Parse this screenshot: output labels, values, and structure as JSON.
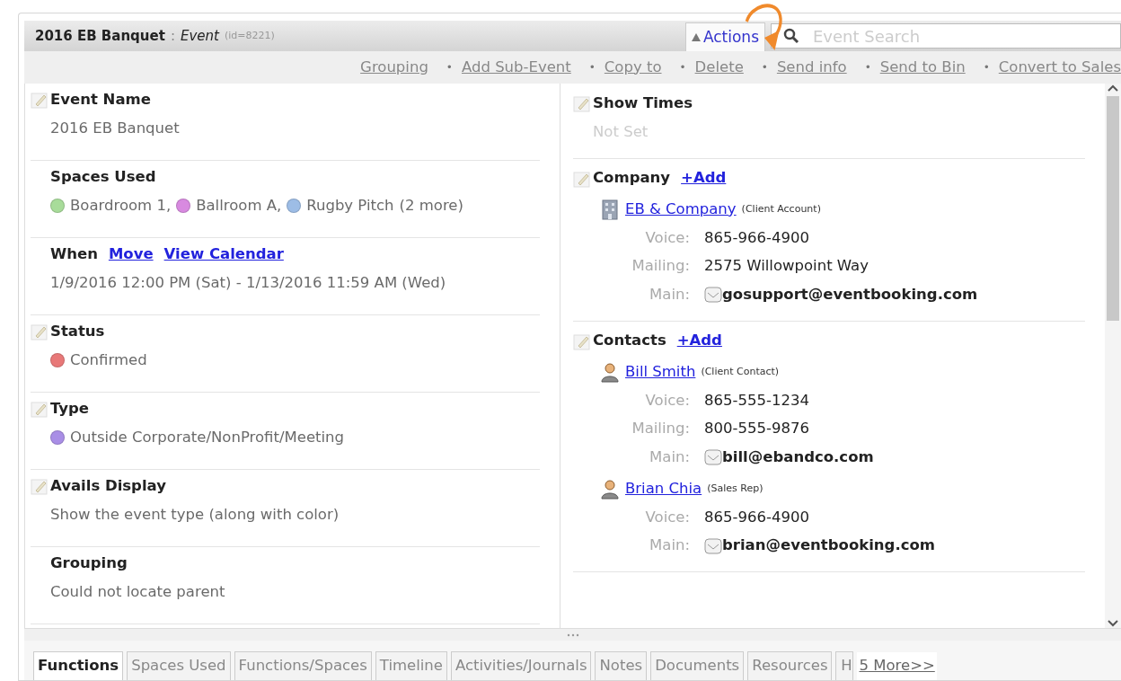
{
  "header": {
    "title": "2016 EB Banquet",
    "separator": ":",
    "type": "Event",
    "id": "(id=8221)",
    "actions_label": "Actions",
    "search": {
      "placeholder": "Event Search"
    }
  },
  "toolbar": [
    {
      "label": "Grouping"
    },
    {
      "bullet": "•",
      "label": "Add Sub-Event"
    },
    {
      "bullet": "•",
      "label": "Copy to"
    },
    {
      "bullet": "•",
      "label": "Delete"
    },
    {
      "bullet": "•",
      "label": "Send info"
    },
    {
      "bullet": "•",
      "label": "Send to Bin"
    },
    {
      "bullet": "•",
      "label": "Convert to Sales"
    }
  ],
  "left_fields": [
    {
      "label": "Event Name",
      "editable": true,
      "kind": "text",
      "value": "2016 EB Banquet"
    },
    {
      "label": "Spaces Used",
      "editable": false,
      "kind": "dots",
      "items": [
        {
          "text": "Boardroom 1,",
          "color": "#a8dc9a"
        },
        {
          "text": "Ballroom A,",
          "color": "#d88ae0"
        },
        {
          "text": "Rugby Pitch",
          "color": "#9dbde6"
        }
      ],
      "more": "(2 more)"
    },
    {
      "label": "When",
      "editable": false,
      "kind": "text",
      "links": [
        "Move",
        "View Calendar"
      ],
      "value": "1/9/2016 12:00 PM (Sat) - 1/13/2016 11:59 AM (Wed)"
    },
    {
      "label": "Status",
      "editable": true,
      "kind": "dots",
      "items": [
        {
          "text": "Confirmed",
          "color": "#e87878"
        }
      ]
    },
    {
      "label": "Type",
      "editable": true,
      "kind": "dots",
      "items": [
        {
          "text": "Outside Corporate/NonProfit/Meeting",
          "color": "#a98ee6"
        }
      ]
    },
    {
      "label": "Avails Display",
      "editable": true,
      "kind": "text",
      "value": "Show the event type (along with color)"
    },
    {
      "label": "Grouping",
      "editable": false,
      "kind": "text",
      "value": "Could not locate parent"
    }
  ],
  "right_sections": [
    {
      "label": "Show Times",
      "editable": true,
      "kind": "text",
      "value": "Not Set",
      "unset": true
    },
    {
      "label": "Company",
      "editable": true,
      "add_link": "+Add",
      "kind": "entities",
      "entities": [
        {
          "kind": "company",
          "name": "EB & Company",
          "role": "(Client Account)",
          "details": [
            {
              "label": "Voice:",
              "value": "865-966-4900",
              "email": false
            },
            {
              "label": "Mailing:",
              "value": "2575 Willowpoint Way",
              "email": false
            },
            {
              "label": "Main:",
              "value": "gosupport@eventbooking.com",
              "email": true
            }
          ]
        }
      ]
    },
    {
      "label": "Contacts",
      "editable": true,
      "add_link": "+Add",
      "kind": "entities",
      "entities": [
        {
          "kind": "person",
          "name": "Bill Smith",
          "role": "(Client Contact)",
          "details": [
            {
              "label": "Voice:",
              "value": "865-555-1234",
              "email": false
            },
            {
              "label": "Mailing:",
              "value": "800-555-9876",
              "email": false
            },
            {
              "label": "Main:",
              "value": "bill@ebandco.com",
              "email": true
            }
          ]
        },
        {
          "kind": "person",
          "name": "Brian Chia",
          "role": "(Sales Rep)",
          "details": [
            {
              "label": "Voice:",
              "value": "865-966-4900",
              "email": false
            },
            {
              "label": "Main:",
              "value": "brian@eventbooking.com",
              "email": true
            }
          ]
        }
      ]
    }
  ],
  "tabs": [
    {
      "label": "Functions",
      "selected": true
    },
    {
      "label": "Spaces Used",
      "selected": false
    },
    {
      "label": "Functions/Spaces",
      "selected": false
    },
    {
      "label": "Timeline",
      "selected": false
    },
    {
      "label": "Activities/Journals",
      "selected": false
    },
    {
      "label": "Notes",
      "selected": false
    },
    {
      "label": "Documents",
      "selected": false
    },
    {
      "label": "Resources",
      "selected": false
    },
    {
      "label": "H",
      "selected": false
    }
  ],
  "more_tabs": "5 More>>"
}
